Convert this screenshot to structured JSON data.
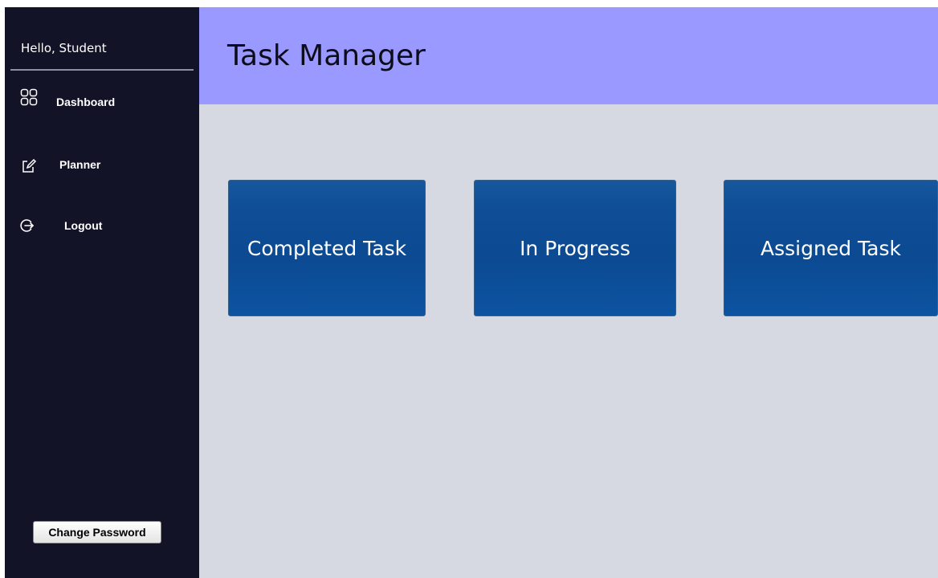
{
  "sidebar": {
    "greeting": "Hello, Student",
    "items": [
      {
        "label": "Dashboard",
        "icon": "dashboard-grid-icon"
      },
      {
        "label": "Planner",
        "icon": "edit-note-icon"
      },
      {
        "label": "Logout",
        "icon": "logout-icon"
      }
    ],
    "change_password_label": "Change Password"
  },
  "header": {
    "title": "Task Manager"
  },
  "cards": [
    {
      "label": "Completed Task"
    },
    {
      "label": "In Progress"
    },
    {
      "label": "Assigned Task"
    }
  ],
  "colors": {
    "sidebar_bg": "#121327",
    "header_bg": "#9999ff",
    "content_bg": "#d6d9e1",
    "card_bg": "#0f4f97"
  }
}
